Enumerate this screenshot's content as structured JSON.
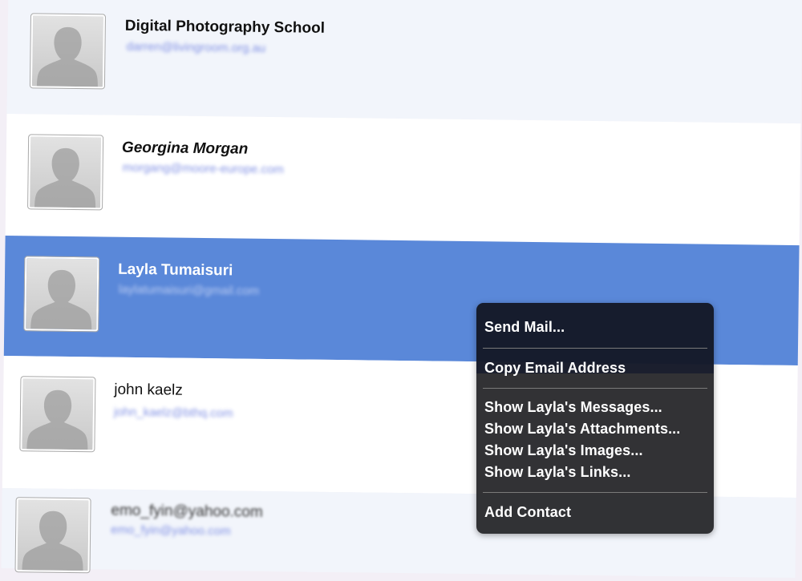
{
  "contacts": [
    {
      "name": "Digital Photography School",
      "email": "darren@livingroom.org.au"
    },
    {
      "name": "Georgina Morgan",
      "email": "morgang@moore-europe.com"
    },
    {
      "name": "Layla Tumaisuri",
      "email": "laylatumaisuri@gmail.com"
    },
    {
      "name": "john kaelz",
      "email": "john_kaelz@bthq.com"
    },
    {
      "name": "emo_fyin@yahoo.com",
      "email": "emo_fyin@yahoo.com"
    }
  ],
  "context_menu": {
    "send_mail": "Send Mail...",
    "copy_email": "Copy Email Address",
    "show_messages": "Show Layla's Messages...",
    "show_attachments": "Show Layla's Attachments...",
    "show_images": "Show Layla's Images...",
    "show_links": "Show Layla's Links...",
    "add_contact": "Add Contact"
  },
  "colors": {
    "selection": "#5a88d9",
    "row_alt": "#f2f5fb",
    "email": "#6d7fe0",
    "menu_bg": "#222226"
  },
  "icons": {
    "avatar": "person-silhouette-icon"
  }
}
